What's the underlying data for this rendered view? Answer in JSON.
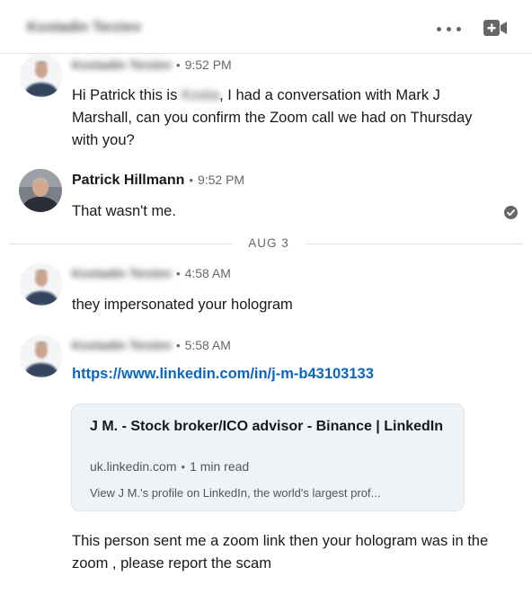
{
  "header": {
    "title": "Kostadin Terziev",
    "more_icon": "more-horizontal-icon",
    "video_icon": "video-call-icon"
  },
  "messages": [
    {
      "sender": "Kostadin Terziev",
      "time": "9:52 PM",
      "text_before": "Hi Patrick this is ",
      "redacted": "Kosta",
      "text_after": ", I had a conversation with Mark J Marshall, can you confirm the Zoom call we had on Thursday with you?"
    },
    {
      "sender": "Patrick Hillmann",
      "time": "9:52 PM",
      "text": "That wasn't me.",
      "status_icon": "read-check-icon"
    },
    {
      "sender": "Kostadin Terziev",
      "time": "4:58 AM",
      "text": "they impersonated your hologram"
    },
    {
      "sender": "Kostadin Terziev",
      "time": "5:58 AM",
      "link": "https://www.linkedin.com/in/j-m-b43103133",
      "preview": {
        "title": "J M. - Stock broker/ICO advisor - Binance | LinkedIn",
        "domain": "uk.linkedin.com",
        "read_time": "1 min read",
        "description": "View J M.'s profile on LinkedIn, the world's largest prof..."
      },
      "text": "This person sent me a zoom link then your hologram was in the zoom , please report the scam"
    }
  ],
  "date_divider": "AUG 3",
  "separator": "•",
  "colors": {
    "link": "#0a66c2",
    "card_bg": "#eef3f8",
    "meta": "#666666"
  }
}
